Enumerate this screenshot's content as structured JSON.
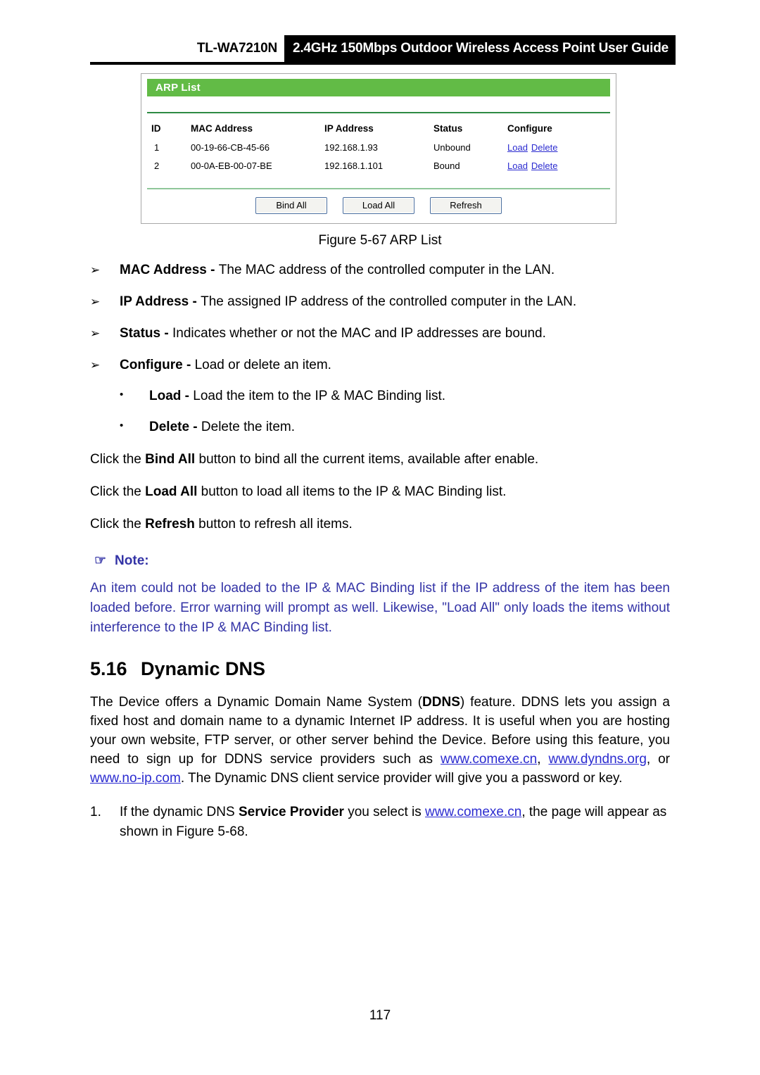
{
  "header": {
    "model": "TL-WA7210N",
    "title": "2.4GHz 150Mbps Outdoor Wireless Access Point User Guide"
  },
  "screenshot": {
    "panel_title": "ARP List",
    "columns": [
      "ID",
      "MAC Address",
      "IP Address",
      "Status",
      "Configure"
    ],
    "rows": [
      {
        "id": "1",
        "mac": "00-19-66-CB-45-66",
        "ip": "192.168.1.93",
        "status": "Unbound",
        "load": "Load",
        "delete": "Delete"
      },
      {
        "id": "2",
        "mac": "00-0A-EB-00-07-BE",
        "ip": "192.168.1.101",
        "status": "Bound",
        "load": "Load",
        "delete": "Delete"
      }
    ],
    "buttons": {
      "bind_all": "Bind All",
      "load_all": "Load All",
      "refresh": "Refresh"
    },
    "colors": {
      "panel_header_green": "#62bb46",
      "link_blue": "#2b2bd0",
      "rule_green": "#2e8b44"
    }
  },
  "figure_caption": "Figure 5-67 ARP List",
  "bullets": [
    {
      "marker": "➢",
      "term": "MAC Address",
      "dash": " - ",
      "text": "The MAC address of the controlled computer in the LAN."
    },
    {
      "marker": "➢",
      "term": "IP Address",
      "dash": " - ",
      "text": "The assigned IP address of the controlled computer in the LAN."
    },
    {
      "marker": "➢",
      "term": "Status",
      "dash": " - ",
      "text": "Indicates whether or not the MAC and IP addresses are bound."
    },
    {
      "marker": "➢",
      "term": "Configure",
      "dash": " - ",
      "text": "Load or delete an item."
    }
  ],
  "sub_bullets": [
    {
      "marker": "•",
      "term": "Load",
      "dash": " - ",
      "text": "Load the item to the IP & MAC Binding list."
    },
    {
      "marker": "•",
      "term": "Delete",
      "dash": " - ",
      "text": "Delete the item."
    }
  ],
  "click_paragraphs": [
    {
      "pre": "Click the ",
      "bold": "Bind All",
      "post": " button to bind all the current items, available after enable."
    },
    {
      "pre": "Click the ",
      "bold": "Load All",
      "post": " button to load all items to the IP & MAC Binding list."
    },
    {
      "pre": "Click the ",
      "bold": "Refresh",
      "post": " button to refresh all items."
    }
  ],
  "note": {
    "hand_icon": "☞",
    "label": "Note:",
    "body": "An item could not be loaded to the IP & MAC Binding list if the IP address of the item has been loaded before. Error warning will prompt as well. Likewise, \"Load All\" only loads the items without interference to the IP & MAC Binding list."
  },
  "section": {
    "number": "5.16",
    "title": "Dynamic DNS"
  },
  "ddns_paragraph": {
    "part1": "The Device offers a Dynamic Domain Name System (",
    "bold1": "DDNS",
    "part2": ") feature. DDNS lets you assign a fixed host and domain name to a dynamic Internet IP address. It is useful when you are hosting your own website, FTP server, or other server behind the Device. Before using this feature, you need to sign up for DDNS service providers such as ",
    "link1": "www.comexe.cn",
    "part3": ", ",
    "link2": "www.dyndns.org",
    "part4": ", or ",
    "link3": "www.no-ip.com",
    "part5": ". The Dynamic DNS client service provider will give you a password or key."
  },
  "numbered_item": {
    "marker": "1.",
    "pre": "If the dynamic DNS ",
    "bold": "Service Provider",
    "mid": " you select is ",
    "link": "www.comexe.cn",
    "post": ", the page will appear as shown in Figure 5-68."
  },
  "page_number": "117"
}
